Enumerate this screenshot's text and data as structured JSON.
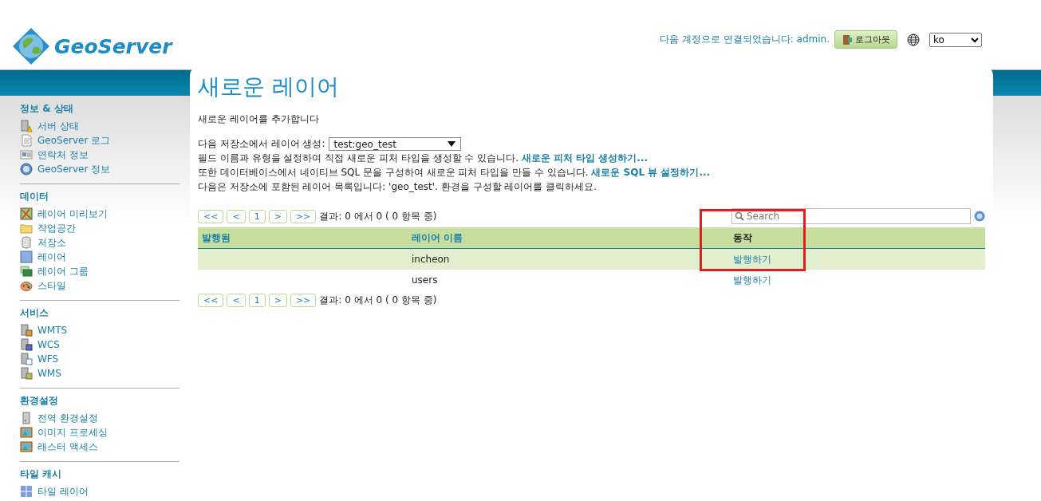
{
  "header": {
    "logo": "GeoServer",
    "login_status": "다음 계정으로 연결되었습니다: admin.",
    "logout_button": "로그아웃",
    "language": "ko"
  },
  "sidebar": {
    "sections": [
      {
        "title": "정보 & 상태",
        "items": [
          "서버 상태",
          "GeoServer 로그",
          "연락처 정보",
          "GeoServer 정보"
        ]
      },
      {
        "title": "데이터",
        "items": [
          "레이어 미리보기",
          "작업공간",
          "저장소",
          "레이어",
          "레이어 그룹",
          "스타일"
        ]
      },
      {
        "title": "서비스",
        "items": [
          "WMTS",
          "WCS",
          "WFS",
          "WMS"
        ]
      },
      {
        "title": "환경설정",
        "items": [
          "전역 환경설정",
          "이미지 프로세싱",
          "래스터 액세스"
        ]
      },
      {
        "title": "타일 캐시",
        "items": [
          "타일 레이어"
        ]
      }
    ]
  },
  "main": {
    "title": "새로운 레이어",
    "subtitle": "새로운 레이어를 추가합니다",
    "store_label": "다음 저장소에서 레이어 생성:",
    "store_value": "test:geo_test",
    "line_1": "필드 이름과 유형을 설정하여 직접 새로운 피처 타입을 생성할 수 있습니다.",
    "link_1": "새로운 피처 타입 생성하기...",
    "line_2": "또한 데이터베이스에서 네이티브 SQL 문을 구성하여 새로운 피처 타입을 만들 수 있습니다.",
    "link_2": "새로운 SQL 뷰 설정하기...",
    "line_3": "다음은 저장소에 포함된 레이어 목록입니다: 'geo_test'. 환경을 구성할 레이어를 클릭하세요.",
    "pager_top": {
      "buttons": [
        "<<",
        "<",
        "1",
        ">",
        ">>"
      ],
      "text": "결과: 0 에서 0 ( 0 항목 중)"
    },
    "pager_bottom": {
      "buttons": [
        "<<",
        "<",
        "1",
        ">",
        ">>"
      ],
      "text": "결과: 0 에서 0 ( 0 항목 중)"
    },
    "search_placeholder": "Search",
    "table": {
      "columns": [
        "발행됨",
        "레이어 이름",
        "동작"
      ],
      "rows": [
        {
          "published": "",
          "name": "incheon",
          "action": "발행하기"
        },
        {
          "published": "",
          "name": "users",
          "action": "발행하기"
        }
      ]
    },
    "highlight": {
      "shown": true
    }
  }
}
